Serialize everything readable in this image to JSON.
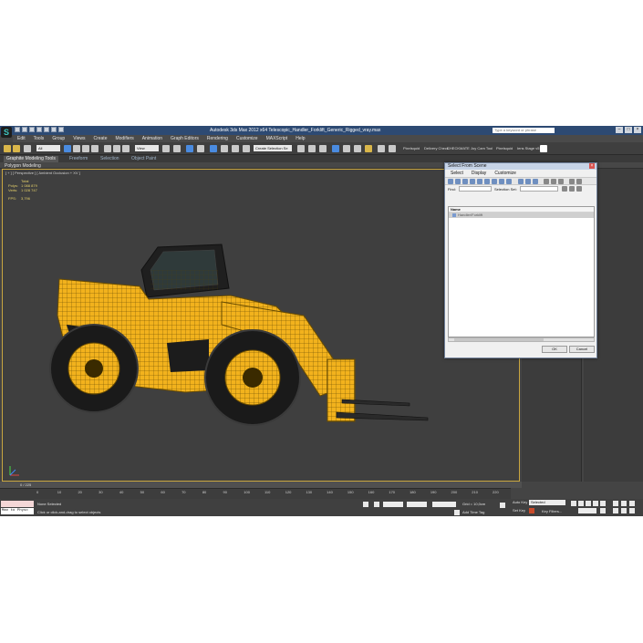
{
  "window": {
    "title": "Autodesk 3ds Max 2012 x64      Telescopic_Handler_Forklift_Generic_Rigged_vray.max",
    "search_placeholder": "Type a keyword or phrase"
  },
  "menubar": {
    "items": [
      "Edit",
      "Tools",
      "Group",
      "Views",
      "Create",
      "Modifiers",
      "Animation",
      "Graph Editors",
      "Rendering",
      "Customize",
      "MAXScript",
      "Help"
    ]
  },
  "toolbar": {
    "selection_filter": "All",
    "ref_coord": "View",
    "named_selection": "Create Selection Se",
    "right_labels": [
      "Pixelsquid",
      "Delivery Check",
      "CHECKMATE",
      "Joy Cam Tool",
      "Pixelsquid",
      "Iens Stage v5"
    ]
  },
  "ribbon": {
    "tabs": [
      "Graphite Modeling Tools",
      "Freeform",
      "Selection",
      "Object Paint"
    ],
    "sub_label": "Polygon Modeling"
  },
  "viewport": {
    "label": "[ + ] [ Perspective ] [ Ambient Occlusion + XV ]",
    "stats": {
      "header": "Total",
      "rows": [
        {
          "label": "Polys:",
          "value": "1 088 879"
        },
        {
          "label": "Verts:",
          "value": "1 028 747"
        }
      ],
      "fps_label": "FPS:",
      "fps_value": "3,796"
    }
  },
  "dialog": {
    "title": "Select From Scene",
    "menu": [
      "Select",
      "Display",
      "Customize"
    ],
    "find_label": "Find:",
    "selection_set_label": "Selection Set:",
    "column_name": "Name",
    "items": [
      "Handler/Forklift"
    ],
    "ok_label": "OK",
    "cancel_label": "Cancel"
  },
  "timeline": {
    "frame": "0 / 225",
    "ticks": [
      "0",
      "10",
      "20",
      "30",
      "40",
      "50",
      "60",
      "70",
      "80",
      "90",
      "100",
      "110",
      "120",
      "130",
      "140",
      "150",
      "160",
      "170",
      "180",
      "190",
      "200",
      "210",
      "220"
    ]
  },
  "status": {
    "maxscript_label": "Max to Physc",
    "line1": "None Selected",
    "line2": "Click or click-and-drag to select objects",
    "grid_label": "Grid = 10,0cm",
    "add_time_tag": "Add Time Tag",
    "auto_key": "Auto Key",
    "set_key": "Set Key",
    "selected": "Selected",
    "key_filters": "Key Filters..."
  },
  "colors": {
    "accent_title": "#2d4a73",
    "model_yellow": "#f2b21d",
    "viewport_bg": "#3f3f3f"
  }
}
